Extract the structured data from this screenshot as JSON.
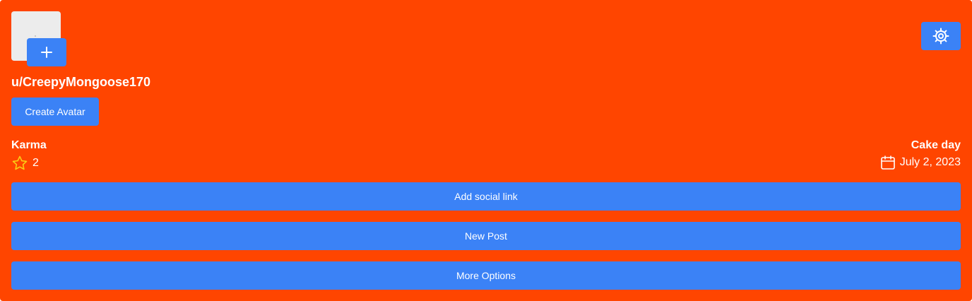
{
  "profile": {
    "username": "u/CreepyMongoose170",
    "create_avatar_label": "Create Avatar",
    "avatar_add_icon": "plus-icon",
    "settings_icon": "gear-icon"
  },
  "stats": {
    "karma_label": "Karma",
    "karma_value": "2",
    "karma_icon": "star-icon",
    "cake_day_label": "Cake day",
    "cake_day_value": "July 2, 2023",
    "cake_day_icon": "calendar-icon"
  },
  "actions": {
    "add_social_link": "Add social link",
    "new_post": "New Post",
    "more_options": "More Options"
  },
  "colors": {
    "card_background": "#ff4500",
    "button_background": "#3b82f6",
    "text": "#ffffff",
    "star": "#facc15"
  }
}
